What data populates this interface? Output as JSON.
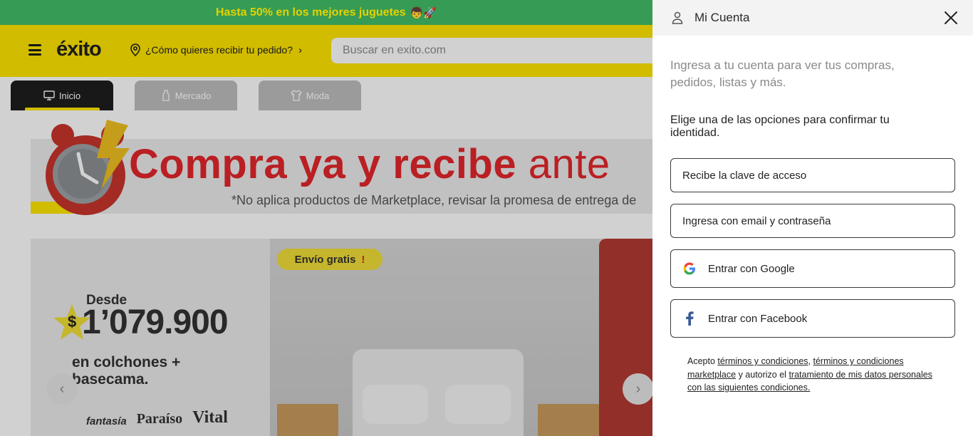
{
  "promo": {
    "text": "Hasta 50% en los mejores juguetes",
    "emoji": "👦🚀"
  },
  "header": {
    "logo": "éxito",
    "delivery_prompt": "¿Cómo quieres recibir tu pedido?",
    "search_placeholder": "Buscar en exito.com"
  },
  "tabs": [
    {
      "label": "Inicio",
      "icon": "monitor-icon"
    },
    {
      "label": "Mercado",
      "icon": "bottle-icon"
    },
    {
      "label": "Moda",
      "icon": "shirt-icon"
    }
  ],
  "banner": {
    "title_bold": "Compra ya y recibe",
    "title_light": "ante",
    "subtitle": "*No aplica productos de Marketplace, revisar la promesa de entrega de"
  },
  "hero": {
    "from_label": "Desde",
    "currency": "$",
    "price": "1’079.900",
    "description": "en colchones + basecama.",
    "brands": [
      "fantasía",
      "Paraíso",
      "Vital"
    ],
    "free_shipping": "Envío gratis",
    "free_shipping_mark": "!"
  },
  "account_panel": {
    "title": "Mi Cuenta",
    "intro": "Ingresa a tu cuenta para ver tus compras, pedidos, listas y más.",
    "choose_prompt": "Elige una de las opciones para confirmar tu identidad.",
    "options": [
      {
        "label": "Recibe la clave de acceso"
      },
      {
        "label": "Ingresa con email y contraseña"
      },
      {
        "label": "Entrar con Google",
        "icon": "google-icon"
      },
      {
        "label": "Entrar con Facebook",
        "icon": "facebook-icon"
      }
    ],
    "terms": {
      "prefix": "Acepto ",
      "link1": "términos y condiciones",
      "sep": ", ",
      "link2": "términos y condiciones marketplace",
      "middle": " y autorizo el ",
      "link3": "tratamiento de mis datos personales con las siguientes condiciones."
    }
  },
  "colors": {
    "brand_yellow": "#ffe600",
    "promo_green": "#3aa55b",
    "accent_red": "#e3262b"
  }
}
